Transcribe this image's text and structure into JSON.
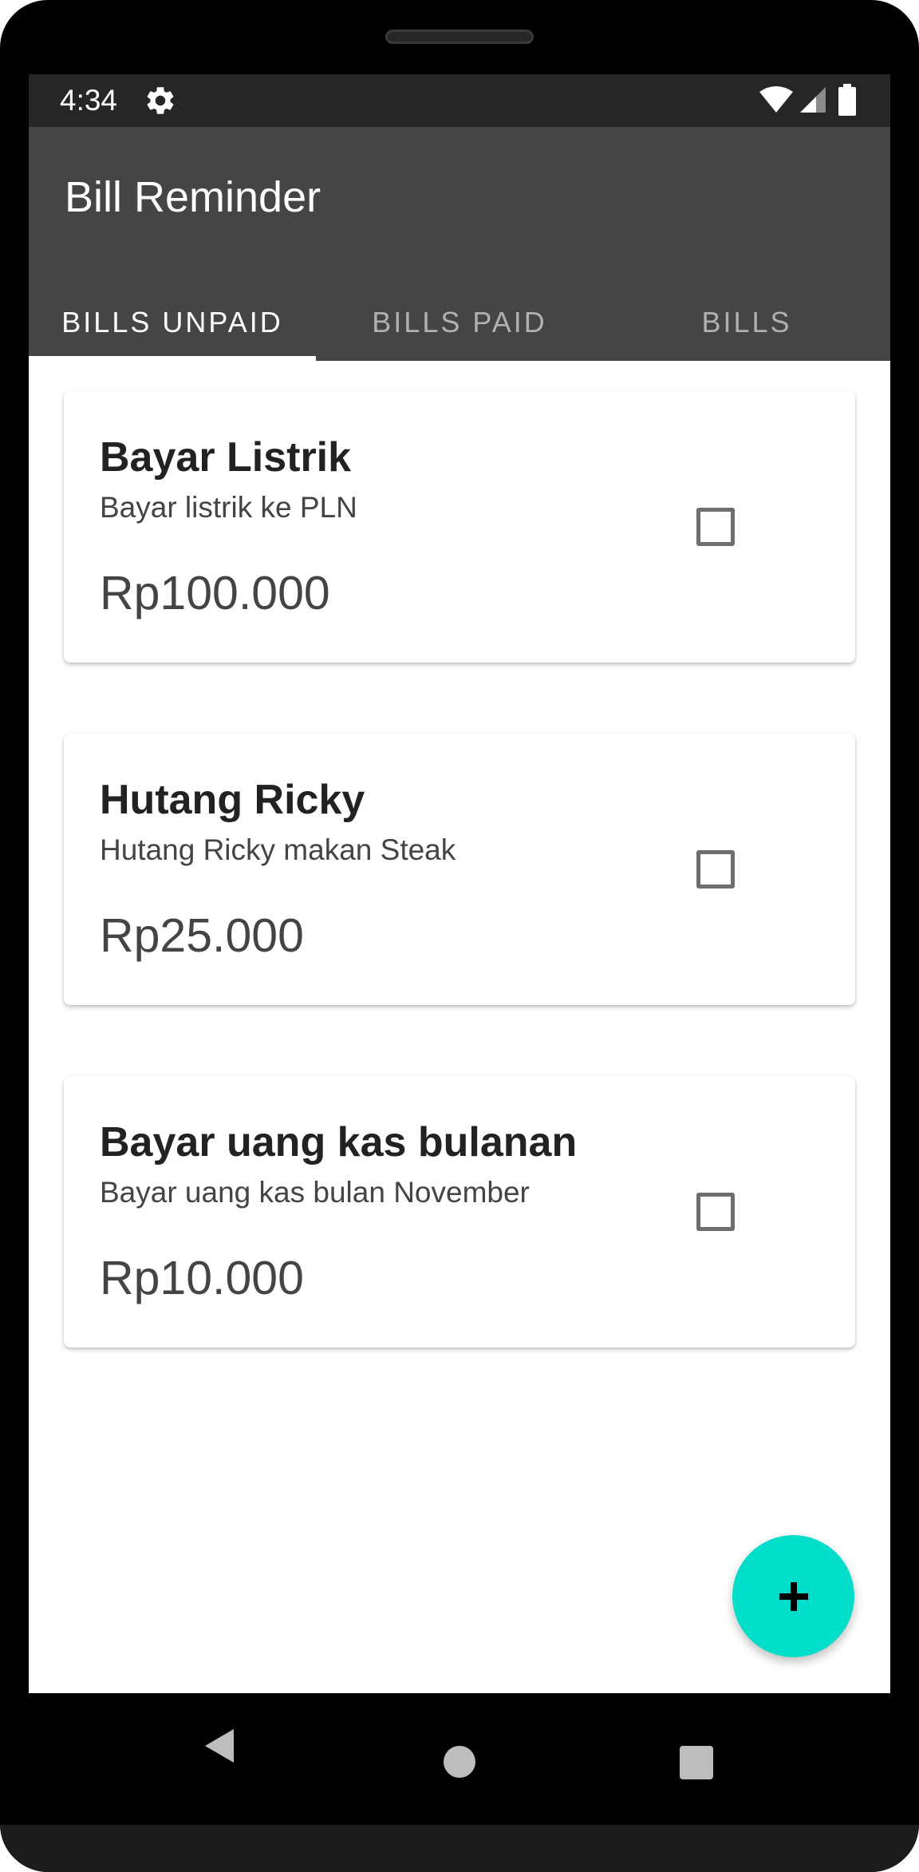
{
  "status_bar": {
    "time": "4:34",
    "icons": [
      "settings-gear-icon",
      "wifi-icon",
      "cell-signal-icon",
      "battery-icon"
    ]
  },
  "app": {
    "title": "Bill Reminder",
    "colors": {
      "status_bar": "#262626",
      "app_bar": "#454545",
      "fab": "#00ddc8",
      "tab_inactive": "#b0b0b0"
    }
  },
  "tabs": [
    {
      "label": "BILLS UNPAID",
      "active": true
    },
    {
      "label": "BILLS PAID",
      "active": false
    },
    {
      "label": "BILLS",
      "active": false
    }
  ],
  "bills": [
    {
      "name": "Bayar Listrik",
      "description": "Bayar listrik ke PLN",
      "amount": "Rp100.000",
      "checked": false
    },
    {
      "name": "Hutang Ricky",
      "description": "Hutang Ricky makan Steak",
      "amount": "Rp25.000",
      "checked": false
    },
    {
      "name": "Bayar uang kas bulanan",
      "description": "Bayar uang kas bulan November",
      "amount": "Rp10.000",
      "checked": false
    }
  ],
  "fab": {
    "icon": "plus-icon"
  },
  "nav_bar": {
    "icons": [
      "back-icon",
      "home-icon",
      "recents-icon"
    ]
  }
}
